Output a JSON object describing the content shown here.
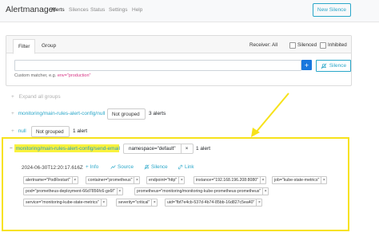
{
  "nav": {
    "brand": "Alertmanager",
    "links": [
      "Alerts",
      "Silences",
      "Status",
      "Settings",
      "Help"
    ],
    "new_silence": "New Silence"
  },
  "filter": {
    "tabs": [
      "Filter",
      "Group"
    ],
    "receiver": "Receiver: All",
    "silenced": "Silenced",
    "inhibited": "Inhibited",
    "plus": "+",
    "silence_btn": "Silence",
    "hint_prefix": "Custom matcher, e.g.",
    "hint_example": "env=\"production\""
  },
  "groups": {
    "expand_all": "Expand all groups",
    "group1": {
      "name": "monitoring/main-rules-alert-config/null",
      "badge": "Not grouped",
      "count": "3 alerts"
    },
    "group2": {
      "name": "null",
      "badge": "Not grouped",
      "count": "1 alert"
    },
    "group3": {
      "name": "monitoring/main-rules-alert-config/send-email",
      "label": "namespace=\"default\"",
      "count": "1 alert"
    }
  },
  "alert": {
    "timestamp": "2024-06-30T12:20:17.616Z",
    "actions": [
      "Info",
      "Source",
      "Silence",
      "Link"
    ],
    "labels": [
      "alertname=\"PodRestart\"",
      "container=\"prometheus\"",
      "endpoint=\"http\"",
      "instance=\"192.168.196.208:8080\"",
      "job=\"kube-state-metrics\"",
      "pod=\"prometheus-deployment-66d7856fc6-gx6f\"",
      "prometheus=\"monitoring/monitoring-kube-prometheus-prometheus\"",
      "service=\"monitoring-kube-state-metrics\"",
      "severity=\"critical\"",
      "uid=\"fbf7e4cb-537d-4b74-85bb-16d827c5ea40\""
    ]
  },
  "colors": {
    "accent": "#2aa7c9",
    "primary": "#1877dd",
    "highlight": "#f9f23e",
    "annotation": "#f7e21a"
  }
}
